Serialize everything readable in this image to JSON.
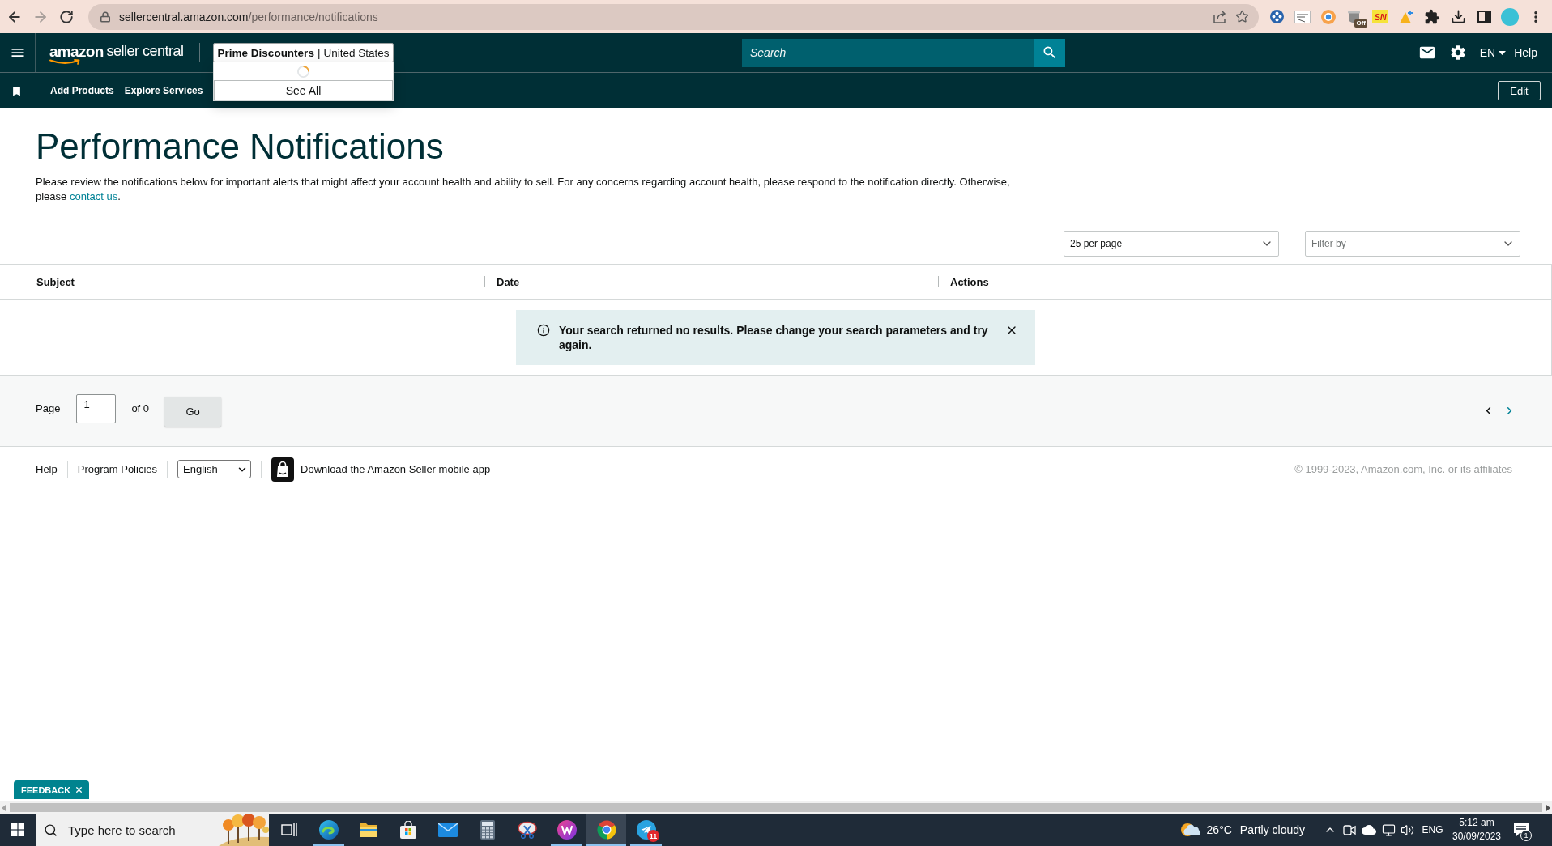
{
  "browser": {
    "back": {
      "disabled": false
    },
    "forward": {
      "disabled": true
    },
    "url": {
      "host": "sellercentral.amazon.com",
      "path": "/performance/notifications"
    },
    "extensions": {
      "badge": "Off",
      "label": "SN"
    }
  },
  "header": {
    "logo": {
      "brand": "amazon",
      "product": "seller central"
    },
    "account_switcher": {
      "account": "Prime Discounters",
      "separator": "|",
      "marketplace": "United States",
      "expanded": true,
      "loading": true,
      "see_all": "See All"
    },
    "search": {
      "placeholder": "Search"
    },
    "language": "EN",
    "help": "Help"
  },
  "nav": {
    "items": [
      {
        "label": "Add Products"
      },
      {
        "label": "Explore Services"
      }
    ],
    "edit": "Edit"
  },
  "page": {
    "title": "Performance Notifications",
    "intro": "Please review the notifications below for important alerts that might affect your account health and ability to sell. For any concerns regarding account health, please respond to the notification directly. Otherwise, please",
    "contact_link": "contact us",
    "intro_end": "."
  },
  "controls": {
    "per_page": {
      "value": "25 per page"
    },
    "filter": {
      "placeholder": "Filter by"
    }
  },
  "table": {
    "columns": [
      "Subject",
      "Date",
      "Actions"
    ],
    "message": "Your search returned no results. Please change your search parameters and try again."
  },
  "pagination": {
    "label": "Page",
    "page": "1",
    "total": "of 0",
    "go": "Go"
  },
  "footer": {
    "links": [
      "Help",
      "Program Policies"
    ],
    "language": "English",
    "app_promo": "Download the Amazon Seller mobile app",
    "copyright": "© 1999-2023, Amazon.com, Inc. or its affiliates"
  },
  "feedback": {
    "label": "FEEDBACK"
  },
  "taskbar": {
    "search": {
      "placeholder": "Type here to search"
    },
    "apps": [
      {
        "running": false,
        "selected": false
      },
      {
        "running": true,
        "selected": false
      },
      {
        "running": false,
        "selected": false
      },
      {
        "running": false,
        "selected": false
      },
      {
        "running": false,
        "selected": false
      },
      {
        "running": false,
        "selected": false
      },
      {
        "running": false,
        "selected": false
      },
      {
        "running": true,
        "selected": false
      },
      {
        "running": true,
        "selected": true
      },
      {
        "running": true,
        "selected": false,
        "badge": "11"
      }
    ],
    "weather": {
      "temperature": "26°C",
      "condition": "Partly cloudy"
    },
    "language": "ENG",
    "time": "5:12 am",
    "date": "30/09/2023",
    "notifications": "1"
  }
}
